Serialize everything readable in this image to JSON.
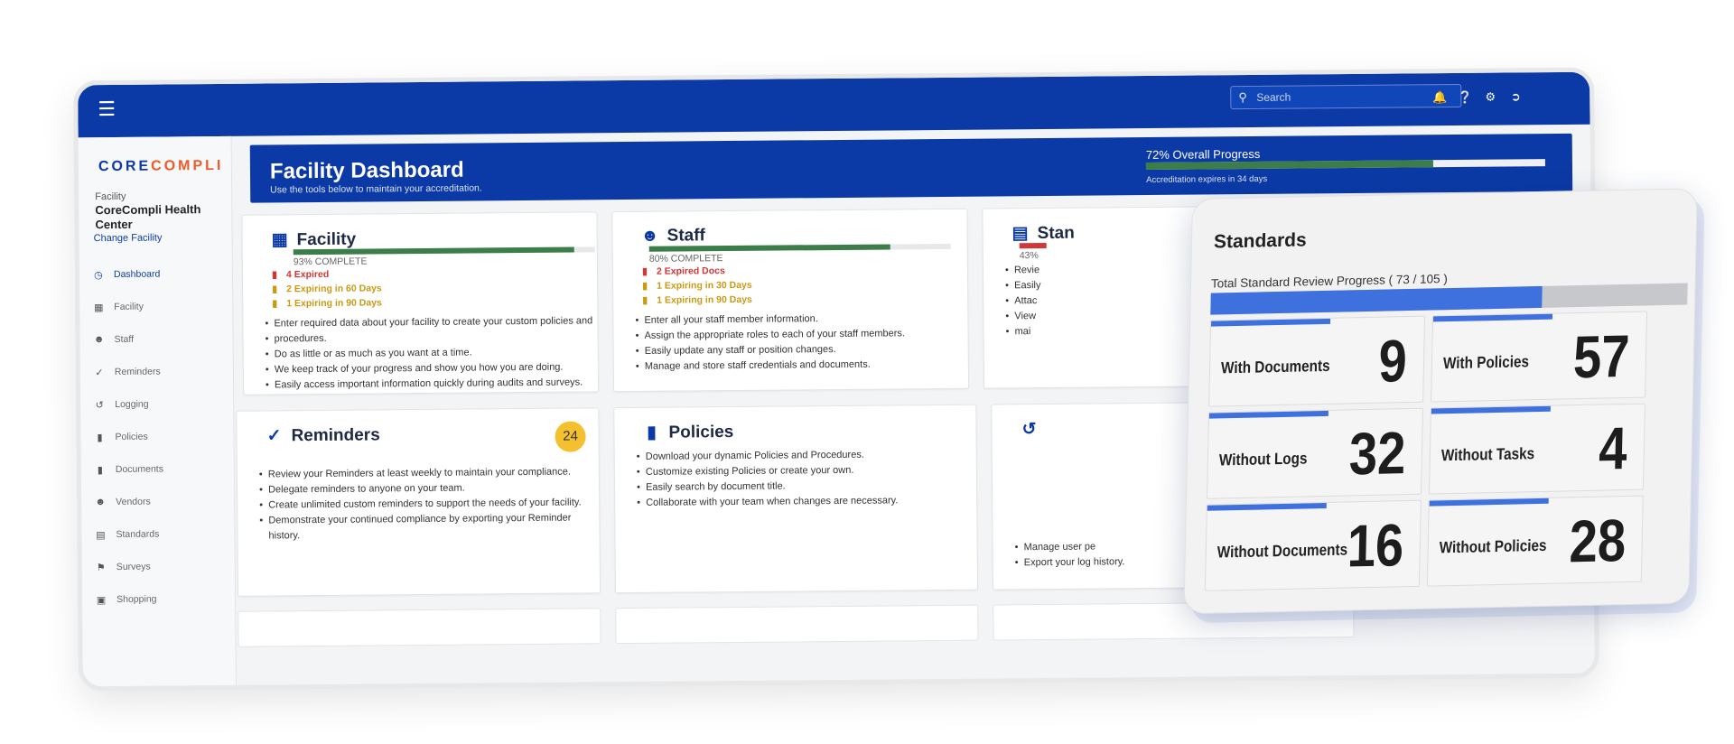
{
  "topbar": {
    "search_placeholder": "Search",
    "icons": [
      "bell-icon",
      "help-icon",
      "gear-icon",
      "logout-icon"
    ]
  },
  "sidebar": {
    "logo_part1": "CORE",
    "logo_part2": "COMPLI",
    "facility_label": "Facility",
    "facility_name": "CoreCompli Health Center",
    "change_facility": "Change Facility",
    "items": [
      {
        "label": "Dashboard",
        "icon": "dashboard-icon"
      },
      {
        "label": "Facility",
        "icon": "building-icon"
      },
      {
        "label": "Staff",
        "icon": "person-icon"
      },
      {
        "label": "Reminders",
        "icon": "check-icon"
      },
      {
        "label": "Logging",
        "icon": "history-icon"
      },
      {
        "label": "Policies",
        "icon": "document-icon"
      },
      {
        "label": "Documents",
        "icon": "file-icon"
      },
      {
        "label": "Vendors",
        "icon": "vendor-icon"
      },
      {
        "label": "Standards",
        "icon": "book-icon"
      },
      {
        "label": "Surveys",
        "icon": "flag-icon"
      },
      {
        "label": "Shopping",
        "icon": "shopping-icon"
      }
    ]
  },
  "banner": {
    "title": "Facility Dashboard",
    "subtitle": "Use the tools below to maintain your accreditation.",
    "progress_label": "72% Overall Progress",
    "progress": 0.72,
    "expires": "Accreditation expires in 34 days"
  },
  "cards": {
    "facility": {
      "title": "Facility",
      "percent_label": "93% COMPLETE",
      "progress": 0.93,
      "stat1": "4 Expired",
      "stat2": "2 Expiring in 60 Days",
      "stat3": "1 Expiring in 90 Days",
      "bullets": [
        "Enter required data about your facility to create your custom policies and",
        "procedures.",
        "Do as little or as much as you want at a time.",
        "We keep track of your progress and show you how you are doing.",
        "Easily access important information quickly during audits and surveys."
      ]
    },
    "staff": {
      "title": "Staff",
      "percent_label": "80% COMPLETE",
      "progress": 0.8,
      "stat1": "2 Expired Docs",
      "stat2": "1 Expiring in 30 Days",
      "stat3": "1 Expiring in 90 Days",
      "bullets": [
        "Enter all your staff member information.",
        "Assign the appropriate roles to each of your staff members.",
        "Easily update any staff or position changes.",
        "Manage and store staff credentials and documents."
      ]
    },
    "standards_partial": {
      "title": "Stan",
      "percent_label": "43%",
      "progress": 0.43,
      "bullets": [
        "Revie",
        "Easily",
        "Attac",
        "View",
        "mai"
      ]
    },
    "reminders": {
      "title": "Reminders",
      "badge": "24",
      "bullets": [
        "Review your Reminders at least weekly to maintain your compliance.",
        "Delegate reminders to anyone on your team.",
        "Create unlimited custom reminders to support the needs of your facility.",
        "Demonstrate your continued compliance by exporting your Reminder history."
      ]
    },
    "policies": {
      "title": "Policies",
      "bullets": [
        "Download your dynamic Policies and Procedures.",
        "Customize existing Policies or create your own.",
        "Easily search by document title.",
        "Collaborate with your team when changes are necessary."
      ]
    },
    "logging_partial": {
      "bullets": [
        "Manage user pe",
        "Export your log history."
      ]
    }
  },
  "overlay": {
    "title": "Standards",
    "progress_label": "Total Standard Review Progress ( 73 / 105 )",
    "progress": 0.695,
    "tiles": [
      {
        "label": "With Documents",
        "value": "9"
      },
      {
        "label": "With Policies",
        "value": "57"
      },
      {
        "label": "Without Logs",
        "value": "32"
      },
      {
        "label": "Without Tasks",
        "value": "4"
      },
      {
        "label": "Without Documents",
        "value": "16"
      },
      {
        "label": "Without Policies",
        "value": "28"
      }
    ]
  }
}
